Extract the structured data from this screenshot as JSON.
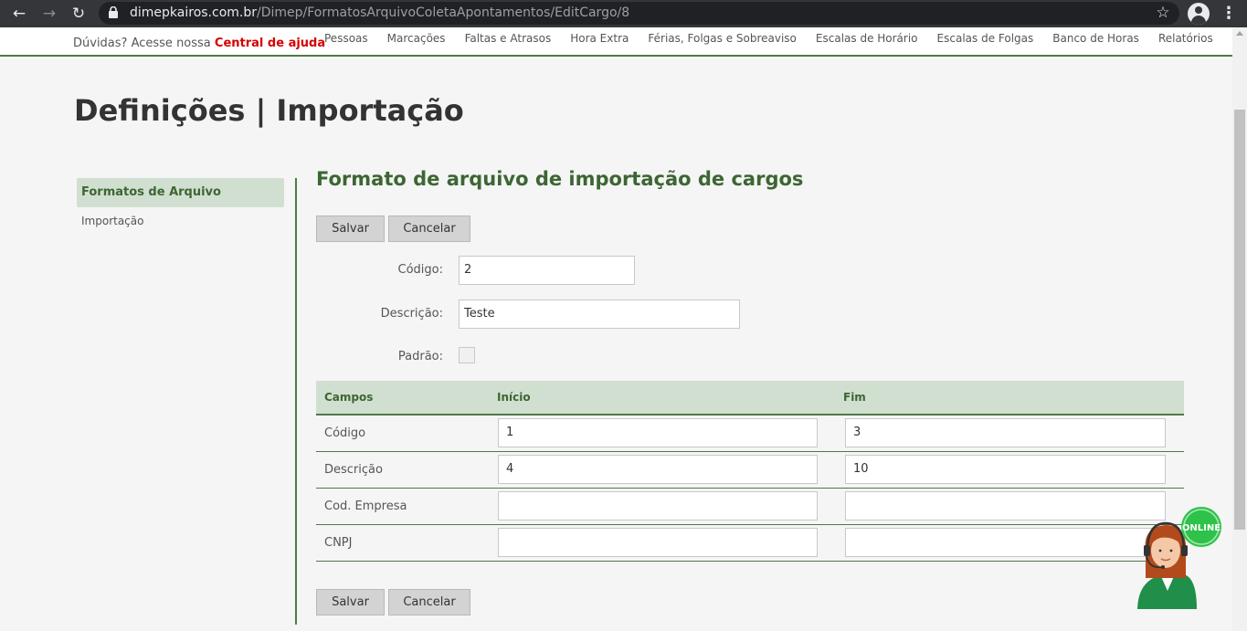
{
  "browser": {
    "url_host": "dimepkairos.com.br",
    "url_path": "/Dimep/FormatosArquivoColetaApontamentos/EditCargo/8"
  },
  "topbar": {
    "help_prefix": "Dúvidas? Acesse nossa",
    "help_link": "Central de ajuda",
    "menu": [
      "Pessoas",
      "Marcações",
      "Faltas e Atrasos",
      "Hora Extra",
      "Férias, Folgas e Sobreaviso",
      "Escalas de Horário",
      "Escalas de Folgas",
      "Banco de Horas",
      "Relatórios"
    ]
  },
  "page_title": "Definições | Importação",
  "sidenav": {
    "active": "Formatos de Arquivo",
    "item": "Importação"
  },
  "form": {
    "title": "Formato de arquivo de importação de cargos",
    "save_label": "Salvar",
    "cancel_label": "Cancelar",
    "codigo_label": "Código:",
    "codigo_value": "2",
    "descricao_label": "Descrição:",
    "descricao_value": "Teste",
    "padrao_label": "Padrão:",
    "padrao_checked": false
  },
  "table": {
    "headers": {
      "campos": "Campos",
      "inicio": "Início",
      "fim": "Fim"
    },
    "rows": [
      {
        "campo": "Código",
        "inicio": "1",
        "fim": "3"
      },
      {
        "campo": "Descrição",
        "inicio": "4",
        "fim": "10"
      },
      {
        "campo": "Cod. Empresa",
        "inicio": "",
        "fim": ""
      },
      {
        "campo": "CNPJ",
        "inicio": "",
        "fim": ""
      }
    ]
  },
  "badge": {
    "text": "ONLINE"
  },
  "colors": {
    "accent_green": "#4e7a45",
    "title_green": "#3c6633",
    "header_bg": "#d1dfd0",
    "help_red": "#d60000"
  }
}
